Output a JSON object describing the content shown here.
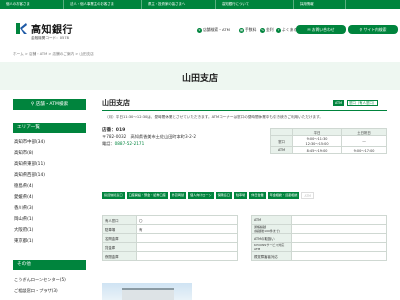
{
  "topbar": {
    "tabs": [
      "個人のお客さま",
      "法人・個人事業主のお客さま",
      "県主・投資家の皆さまへ",
      "高知銀行について",
      "採用情報"
    ]
  },
  "header": {
    "logo_text": "高知銀行",
    "bank_code": "金融機関コード：0578",
    "nav": [
      {
        "icon": "yen-icon",
        "label": "店舗検索・ATM"
      },
      {
        "icon": "calculator-icon",
        "label": "手数料"
      },
      {
        "icon": "rate-icon",
        "label": "金利"
      },
      {
        "icon": "question-icon",
        "label": "よくある質問"
      }
    ],
    "buttons": [
      "お問い合わせ",
      "サイト内検索"
    ]
  },
  "breadcrumb": "ホーム > 店舗・ATM > 店舗のご案内 > 山田支店",
  "page_title": "山田支店",
  "sidebar": {
    "search_button": "店舗・ATM検索",
    "area_heading": "エリア一覧",
    "areas": [
      "高知市中部(34)",
      "高知市(8)",
      "高知県東部(11)",
      "高知県西部(14)",
      "徳島県(4)",
      "愛媛県(4)",
      "香川県(3)",
      "岡山県(1)",
      "大阪府(1)",
      "東京都(1)"
    ],
    "extra_heading": "その他",
    "extras": [
      "こうぎんローンセンター(5)",
      "ご相談窓口・プラザ(3)"
    ]
  },
  "main": {
    "branch_name": "山田支店",
    "tags": [
      "ATM",
      "窓口（有人窓口）"
    ],
    "notice": "（月）平日11:30～12:30は、昼時間休業とさせていただきます。ATMコーナーは窓口の昼時間休業中も引き続きご利用いただけます。",
    "store_no": "店番：019",
    "address": "〒782-0032　高知県香美市土佐山田町本町3-2-2",
    "tel_label": "電話：",
    "tel": "0887-52-2171"
  },
  "hours": {
    "col1": "平日",
    "col2": "土日祝日",
    "madoguchi_label": "窓口",
    "madoguchi_weekday": "9:00～11:30\n12:30～15:00",
    "madoguchi_weekend": "―",
    "atm_label": "ATM",
    "atm_weekday": "8:45～19:00",
    "atm_weekend": "9:00～17:00"
  },
  "services": [
    {
      "label": "投資信託窓口",
      "on": true
    },
    {
      "label": "口座開設・預金・証券口座",
      "on": true
    },
    {
      "label": "外貨両替",
      "on": true
    },
    {
      "label": "個人向けローン",
      "on": true
    },
    {
      "label": "保険窓口",
      "on": true
    },
    {
      "label": "駐車場",
      "on": true
    },
    {
      "label": "休日営業",
      "on": true
    },
    {
      "label": "年金相談・資産相談",
      "on": true
    },
    {
      "label": "ATM",
      "on": false
    }
  ],
  "facility_left": [
    {
      "k": "有人窓口",
      "v": "〇"
    },
    {
      "k": "駐車場",
      "v": "有"
    },
    {
      "k": "名問金庫",
      "v": ""
    },
    {
      "k": "貸金庫",
      "v": ""
    },
    {
      "k": "夜間金庫",
      "v": ""
    }
  ],
  "facility_right": [
    {
      "k": "ATM",
      "v": ""
    },
    {
      "k": "通帳繰越\n(繰越後100件まで)",
      "v": ""
    },
    {
      "k": "ATMの取扱い",
      "v": ""
    },
    {
      "k": "KYOUNSサービス対応ATM",
      "v": ""
    },
    {
      "k": "視覚障害者対応",
      "v": ""
    }
  ],
  "colors": {
    "brand": "#00843d",
    "light": "#eef7f1"
  }
}
